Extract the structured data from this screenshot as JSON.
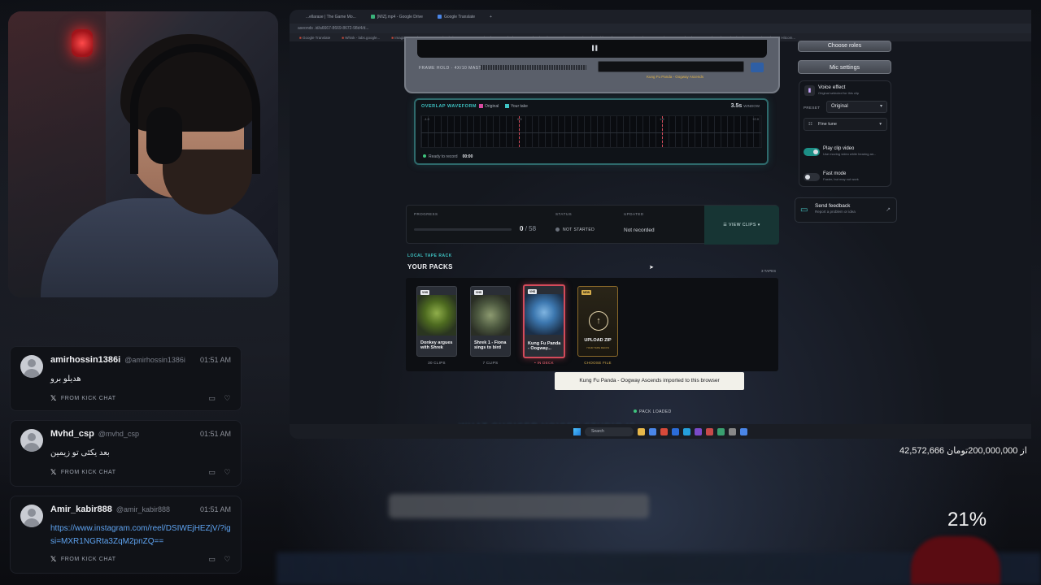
{
  "browser": {
    "tabs": [
      {
        "label": "...ellarase | The Game Mo..."
      },
      {
        "label": "[MIZ].mp4 - Google Drive"
      },
      {
        "label": "Google Translate"
      }
    ],
    "address": "aseonds .id/a6667-8669-8672-98d4/d...",
    "bookmarks": [
      "Google Translate",
      "Whisk - labs.google...",
      "Imagine - Grok",
      "Top Simulation gam...",
      "(687) Mox Rank Th...",
      "(957) I ruk & 27 and...",
      "(1046) David Bambo...",
      "(3847) TR1 Records...",
      "(139) ...",
      "(1328) Mortic Plural...",
      "(1322) Brex Hitcom..."
    ]
  },
  "film": {
    "meta": "FRAME HOLD · 4X/10 MASTER",
    "caption": "Kung Fu Panda - Oogway Ascends"
  },
  "waveform": {
    "title": "OVERLAP WAVEFORM",
    "legend_original": "Original",
    "legend_take": "Your take",
    "window_value": "3.5s",
    "window_label": "WINDOW",
    "ticks": [
      "-1.0",
      "0.0",
      "1.5",
      "+2.0"
    ],
    "ready_label": "Ready to record",
    "ready_time": "00:00"
  },
  "side": {
    "choose_roles": "Choose roles",
    "mic_settings": "Mic settings",
    "voice_effect_title": "Voice effect",
    "voice_effect_sub": "Original selected for this clip",
    "preset_label": "PRESET",
    "preset_value": "Original",
    "fine_tune": "Fine tune",
    "play_clip_title": "Play clip video",
    "play_clip_sub": "Use moving video while hearing an...",
    "fast_mode_title": "Fast mode",
    "fast_mode_sub": "Faster, but may not work",
    "feedback_title": "Send feedback",
    "feedback_sub": "Report a problem or idea"
  },
  "stats": {
    "progress_label": "PROGRESS",
    "progress_done": "0",
    "progress_total": "58",
    "progress_fraction": 0,
    "status_label": "STATUS",
    "status_value": "NOT STARTED",
    "updated_label": "UPDATED",
    "updated_value": "Not recorded",
    "view_clips": "VIEW CLIPS"
  },
  "packs": {
    "eyebrow": "LOCAL TAPE RACK",
    "title": "YOUR PACKS",
    "tapes": "3 TAPES",
    "cards": [
      {
        "badge": "VHS",
        "name": "Donkey argues with Shrek",
        "caption": "30 CLIPS"
      },
      {
        "badge": "VHS",
        "name": "Shrek 1 - Fiona sings to bird",
        "caption": "7 CLIPS"
      },
      {
        "badge": "VHS",
        "name": "Kung Fu Panda - Oogway...",
        "caption": "• IN DECK"
      },
      {
        "badge": "NEW",
        "name": "UPLOAD ZIP",
        "sub": "YOUR TAPE DECKS",
        "caption": "CHOOSE FILE"
      }
    ],
    "toast": "Kung Fu Panda - Oogway Ascends imported to this browser",
    "loaded": "PACK LOADED",
    "below_text": "WHAT CHOICER VOICER STUDIO IS"
  },
  "taskbar": {
    "search": "Search"
  },
  "chat": [
    {
      "user": "amirhossin1386i",
      "handle": "@amirhossin1386i",
      "time": "01:51 AM",
      "message": "هدیلو برو",
      "source": "FROM KICK CHAT"
    },
    {
      "user": "Mvhd_csp",
      "handle": "@mvhd_csp",
      "time": "01:51 AM",
      "message": "بعد یکئی تو زیمین",
      "source": "FROM KICK CHAT"
    },
    {
      "user": "Amir_kabir888",
      "handle": "@amir_kabir888",
      "time": "01:51 AM",
      "message": "https://www.instagram.com/reel/DSIWEjHEZjV/?igsi=MXR1NGRta3ZqM2pnZQ==",
      "source": "FROM KICK CHAT"
    }
  ],
  "donation": {
    "text": "42,572,666 از 200,000,000تومان",
    "percent": "21%"
  },
  "colors": {
    "accent": "#3ec3c3",
    "selected": "#d44a5a",
    "link": "#5ea3f0"
  }
}
